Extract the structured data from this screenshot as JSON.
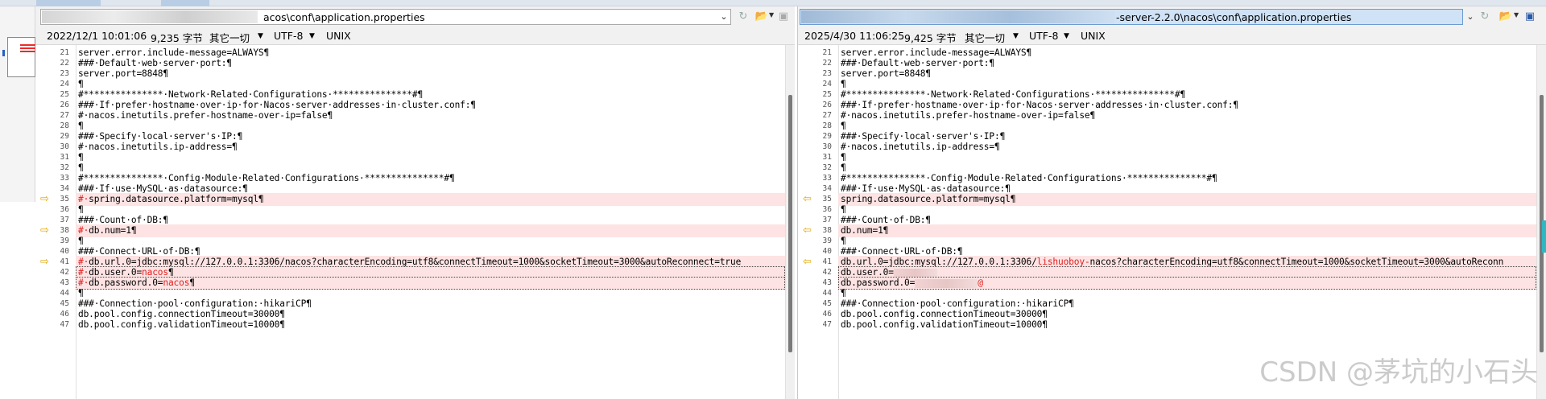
{
  "left": {
    "path_suffix": "acos\\conf\\application.properties",
    "status": {
      "datetime": "2022/12/1 10:01:06",
      "size": "9,235 字节",
      "eol_mode": "其它一切",
      "encoding": "UTF-8",
      "line_ending": "UNIX"
    },
    "lines": [
      {
        "n": "21",
        "t": "server.error.include-message=ALWAYS¶"
      },
      {
        "n": "22",
        "t": "###·Default·web·server·port:¶"
      },
      {
        "n": "23",
        "t": "server.port=8848¶"
      },
      {
        "n": "24",
        "t": "¶"
      },
      {
        "n": "25",
        "t": "#***************·Network·Related·Configurations·***************#¶"
      },
      {
        "n": "26",
        "t": "###·If·prefer·hostname·over·ip·for·Nacos·server·addresses·in·cluster.conf:¶"
      },
      {
        "n": "27",
        "t": "#·nacos.inetutils.prefer-hostname-over-ip=false¶"
      },
      {
        "n": "28",
        "t": "¶"
      },
      {
        "n": "29",
        "t": "###·Specify·local·server's·IP:¶"
      },
      {
        "n": "30",
        "t": "#·nacos.inetutils.ip-address=¶"
      },
      {
        "n": "31",
        "t": "¶"
      },
      {
        "n": "32",
        "t": "¶"
      },
      {
        "n": "33",
        "t": "#***************·Config·Module·Related·Configurations·***************#¶"
      },
      {
        "n": "34",
        "t": "###·If·use·MySQL·as·datasource:¶"
      },
      {
        "n": "35",
        "p": "#·",
        "t": "spring.datasource.platform=mysql¶",
        "diff": true,
        "arrow": "⇨"
      },
      {
        "n": "36",
        "t": "¶"
      },
      {
        "n": "37",
        "t": "###·Count·of·DB:¶"
      },
      {
        "n": "38",
        "p": "#·",
        "t": "db.num=1¶",
        "diff": true,
        "arrow": "⇨"
      },
      {
        "n": "39",
        "t": "¶"
      },
      {
        "n": "40",
        "t": "###·Connect·URL·of·DB:¶"
      },
      {
        "n": "41",
        "p": "#·",
        "t": "db.url.0=jdbc:mysql://127.0.0.1:3306/nacos?characterEncoding=utf8&connectTimeout=1000&socketTimeout=3000&autoReconnect=true",
        "diff": true,
        "arrow": "⇨"
      },
      {
        "n": "42",
        "p": "#·",
        "t": "db.user.0=",
        "i": "nacos",
        "s": "¶",
        "diff": true,
        "box": true
      },
      {
        "n": "43",
        "p": "#·",
        "t": "db.password.0=",
        "i": "nacos",
        "s": "¶",
        "diff": true,
        "box": true
      },
      {
        "n": "44",
        "t": "¶"
      },
      {
        "n": "45",
        "t": "###·Connection·pool·configuration:·hikariCP¶"
      },
      {
        "n": "46",
        "t": "db.pool.config.connectionTimeout=30000¶"
      },
      {
        "n": "47",
        "t": "db.pool.config.validationTimeout=10000¶"
      }
    ]
  },
  "right": {
    "path_suffix": "-server-2.2.0\\nacos\\conf\\application.properties",
    "status": {
      "datetime": "2025/4/30 11:06:25",
      "size": "9,425 字节",
      "eol_mode": "其它一切",
      "encoding": "UTF-8",
      "line_ending": "UNIX"
    },
    "lines": [
      {
        "n": "21",
        "t": "server.error.include-message=ALWAYS¶"
      },
      {
        "n": "22",
        "t": "###·Default·web·server·port:¶"
      },
      {
        "n": "23",
        "t": "server.port=8848¶"
      },
      {
        "n": "24",
        "t": "¶"
      },
      {
        "n": "25",
        "t": "#***************·Network·Related·Configurations·***************#¶"
      },
      {
        "n": "26",
        "t": "###·If·prefer·hostname·over·ip·for·Nacos·server·addresses·in·cluster.conf:¶"
      },
      {
        "n": "27",
        "t": "#·nacos.inetutils.prefer-hostname-over-ip=false¶"
      },
      {
        "n": "28",
        "t": "¶"
      },
      {
        "n": "29",
        "t": "###·Specify·local·server's·IP:¶"
      },
      {
        "n": "30",
        "t": "#·nacos.inetutils.ip-address=¶"
      },
      {
        "n": "31",
        "t": "¶"
      },
      {
        "n": "32",
        "t": "¶"
      },
      {
        "n": "33",
        "t": "#***************·Config·Module·Related·Configurations·***************#¶"
      },
      {
        "n": "34",
        "t": "###·If·use·MySQL·as·datasource:¶"
      },
      {
        "n": "35",
        "t": "spring.datasource.platform=mysql¶",
        "diff": true,
        "arrow": "⇦"
      },
      {
        "n": "36",
        "t": "¶"
      },
      {
        "n": "37",
        "t": "###·Count·of·DB:¶"
      },
      {
        "n": "38",
        "t": "db.num=1¶",
        "diff": true,
        "arrow": "⇦"
      },
      {
        "n": "39",
        "t": "¶"
      },
      {
        "n": "40",
        "t": "###·Connect·URL·of·DB:¶"
      },
      {
        "n": "41",
        "t": "db.url.0=jdbc:mysql://127.0.0.1:3306/",
        "i": "lishuoboy-",
        "s": "nacos?characterEncoding=utf8&connectTimeout=1000&socketTimeout=3000&autoReconn",
        "diff": true,
        "arrow": "⇦"
      },
      {
        "n": "42",
        "t": "db.user.0=",
        "redact": "narrow",
        "diff": true,
        "box": true
      },
      {
        "n": "43",
        "t": "db.password.0=",
        "redact": "wide",
        "i": "@",
        "diff": true,
        "box": true
      },
      {
        "n": "44",
        "t": "¶"
      },
      {
        "n": "45",
        "t": "###·Connection·pool·configuration:·hikariCP¶"
      },
      {
        "n": "46",
        "t": "db.pool.config.connectionTimeout=30000¶"
      },
      {
        "n": "47",
        "t": "db.pool.config.validationTimeout=10000¶"
      }
    ]
  },
  "watermark": "CSDN @茅坑的小石头",
  "icons": [
    "folder-open-icon",
    "save-icon",
    "refresh-icon",
    "dropdown-arrow-icon"
  ]
}
